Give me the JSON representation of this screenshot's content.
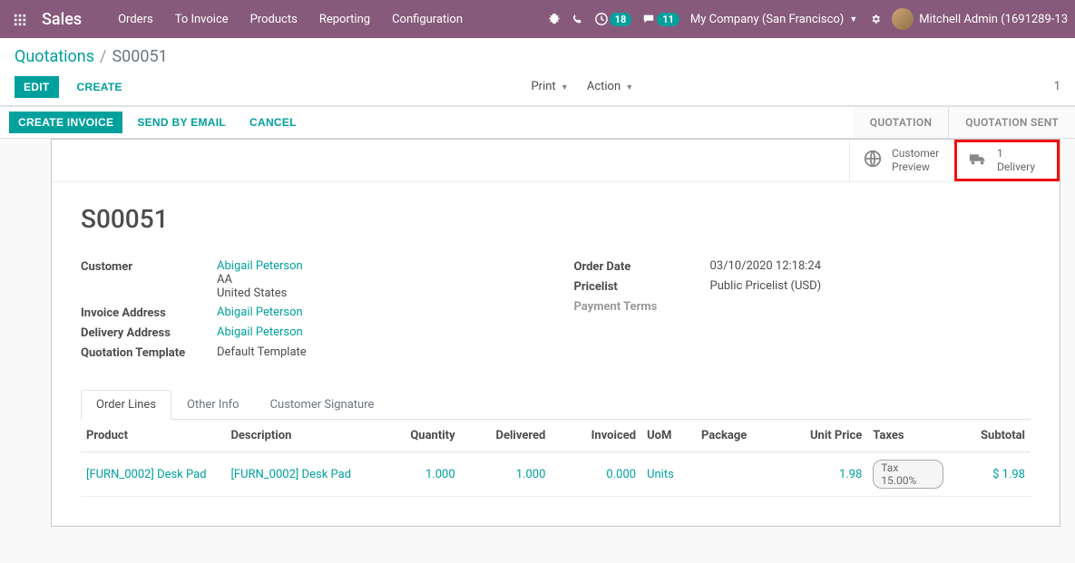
{
  "navbar": {
    "brand": "Sales",
    "menu": [
      "Orders",
      "To Invoice",
      "Products",
      "Reporting",
      "Configuration"
    ],
    "activities_badge": "18",
    "discuss_badge": "11",
    "company": "My Company (San Francisco)",
    "username": "Mitchell Admin (1691289-13"
  },
  "breadcrumb": {
    "root": "Quotations",
    "current": "S00051"
  },
  "ctrl": {
    "edit": "EDIT",
    "create": "CREATE",
    "print": "Print",
    "action": "Action",
    "pager": "1"
  },
  "statusbar": {
    "create_invoice": "CREATE INVOICE",
    "send_email": "SEND BY EMAIL",
    "cancel": "CANCEL",
    "step1": "QUOTATION",
    "step2": "QUOTATION SENT"
  },
  "btnbox": {
    "preview": {
      "l1": "Customer",
      "l2": "Preview"
    },
    "delivery": {
      "count": "1",
      "label": "Delivery"
    }
  },
  "record": {
    "name": "S00051",
    "left": {
      "customer_label": "Customer",
      "customer": "Abigail Peterson",
      "customer_sub1": "AA",
      "customer_sub2": "United States",
      "invoice_addr_label": "Invoice Address",
      "invoice_addr": "Abigail Peterson",
      "delivery_addr_label": "Delivery Address",
      "delivery_addr": "Abigail Peterson",
      "quote_tpl_label": "Quotation Template",
      "quote_tpl": "Default Template"
    },
    "right": {
      "order_date_label": "Order Date",
      "order_date": "03/10/2020 12:18:24",
      "pricelist_label": "Pricelist",
      "pricelist": "Public Pricelist (USD)",
      "payment_terms_label": "Payment Terms",
      "payment_terms": ""
    }
  },
  "tabs": [
    "Order Lines",
    "Other Info",
    "Customer Signature"
  ],
  "table": {
    "headers": {
      "product": "Product",
      "description": "Description",
      "quantity": "Quantity",
      "delivered": "Delivered",
      "invoiced": "Invoiced",
      "uom": "UoM",
      "package": "Package",
      "unit_price": "Unit Price",
      "taxes": "Taxes",
      "subtotal": "Subtotal"
    },
    "row": {
      "product": "[FURN_0002] Desk Pad",
      "description": "[FURN_0002] Desk Pad",
      "quantity": "1.000",
      "delivered": "1.000",
      "invoiced": "0.000",
      "uom": "Units",
      "package": "",
      "unit_price": "1.98",
      "tax": "Tax 15.00%",
      "subtotal": "$ 1.98"
    }
  }
}
